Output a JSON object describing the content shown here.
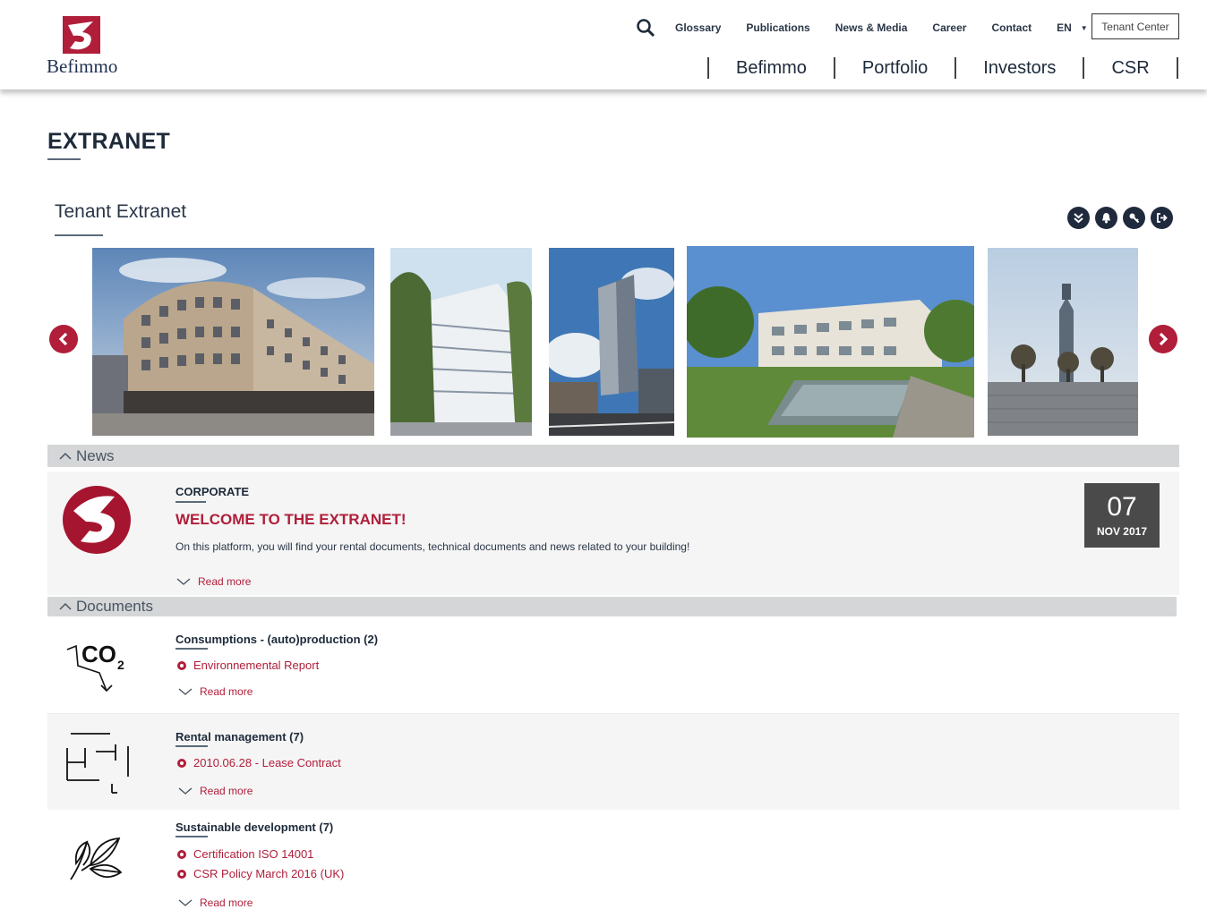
{
  "header": {
    "logo_text": "Befimmo",
    "top_links": [
      "Glossary",
      "Publications",
      "News & Media",
      "Career",
      "Contact"
    ],
    "language": "EN",
    "tenant_center": "Tenant Center",
    "main_nav": [
      "Befimmo",
      "Portfolio",
      "Investors",
      "CSR"
    ]
  },
  "page": {
    "title": "EXTRANET",
    "subtitle": "Tenant Extranet"
  },
  "news": {
    "section_label": "News",
    "category": "CORPORATE",
    "title": "WELCOME TO THE EXTRANET!",
    "description": "On this platform, you will find your rental documents, technical documents and news related to your building!",
    "read_more": "Read more",
    "date_day": "07",
    "date_month_year": "NOV 2017"
  },
  "documents": {
    "section_label": "Documents",
    "items": [
      {
        "title": "Consumptions - (auto)production (2)",
        "links": [
          "Environnemental Report"
        ],
        "read_more": "Read more",
        "icon": "co2-icon"
      },
      {
        "title": "Rental management (7)",
        "links": [
          "2010.06.28 - Lease Contract"
        ],
        "read_more": "Read more",
        "icon": "floorplan-icon"
      },
      {
        "title": "Sustainable development (7)",
        "links": [
          "Certification ISO 14001",
          "CSR Policy March 2016 (UK)"
        ],
        "read_more": "Read more",
        "icon": "leaf-icon"
      }
    ]
  },
  "colors": {
    "brand_red": "#b01e3a",
    "navy": "#1d2a3a",
    "section_bar": "#d4d6d8"
  }
}
